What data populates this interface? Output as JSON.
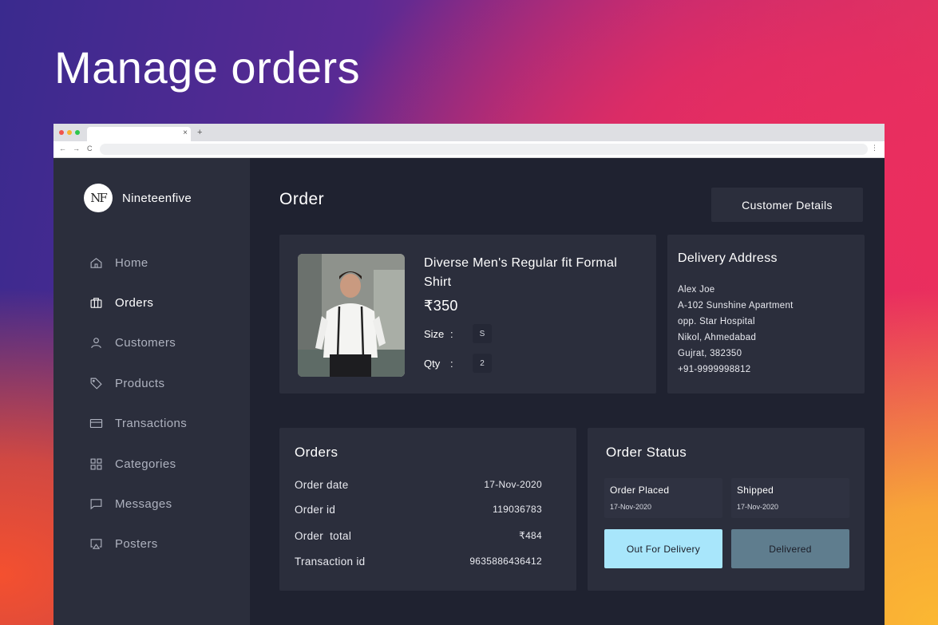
{
  "hero": {
    "title": "Manage orders"
  },
  "browser": {
    "tab_close": "×",
    "new_tab": "+",
    "back": "←",
    "forward": "→",
    "reload": "C",
    "menu": "⋮"
  },
  "sidebar": {
    "brand": {
      "logo_text": "NF",
      "name": "Nineteenfive"
    },
    "items": [
      {
        "label": "Home",
        "icon": "home-icon",
        "active": false
      },
      {
        "label": "Orders",
        "icon": "briefcase-icon",
        "active": true
      },
      {
        "label": "Customers",
        "icon": "user-icon",
        "active": false
      },
      {
        "label": "Products",
        "icon": "tag-icon",
        "active": false
      },
      {
        "label": "Transactions",
        "icon": "credit-card-icon",
        "active": false
      },
      {
        "label": "Categories",
        "icon": "grid-icon",
        "active": false
      },
      {
        "label": "Messages",
        "icon": "message-icon",
        "active": false
      },
      {
        "label": "Posters",
        "icon": "cast-icon",
        "active": false
      }
    ]
  },
  "main": {
    "title": "Order",
    "customer_details_label": "Customer Details",
    "product": {
      "name": "Diverse Men's Regular fit Formal Shirt",
      "price": "₹350",
      "size_label": "Size",
      "size_sep": ":",
      "size_value": "S",
      "qty_label": "Qty",
      "qty_sep": ":",
      "qty_value": "2"
    },
    "delivery": {
      "title": "Delivery Address",
      "lines": [
        "Alex Joe",
        "A-102 Sunshine Apartment",
        "opp. Star Hospital",
        "Nikol, Ahmedabad",
        "Gujrat, 382350",
        "+91-9999998812"
      ]
    },
    "orders": {
      "title": "Orders",
      "rows": [
        {
          "label": "Order date",
          "value": "17-Nov-2020"
        },
        {
          "label": "Order id",
          "value": "119036783"
        },
        {
          "label": "Order  total",
          "value": "₹484"
        },
        {
          "label": "Transaction id",
          "value": "9635886436412"
        }
      ]
    },
    "status": {
      "title": "Order Status",
      "steps": [
        {
          "label": "Order Placed",
          "date": "17-Nov-2020"
        },
        {
          "label": "Shipped",
          "date": "17-Nov-2020"
        }
      ],
      "out_for_delivery_label": "Out For Delivery",
      "delivered_label": "Delivered",
      "colors": {
        "out_for_delivery": "#a8e6fb",
        "delivered": "#5f7d8e"
      }
    }
  }
}
